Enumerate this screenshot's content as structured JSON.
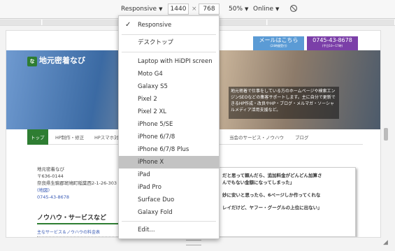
{
  "toolbar": {
    "device_label": "Responsive",
    "width": "1440",
    "times": "×",
    "height": "768",
    "zoom": "50%",
    "throttle": "Online"
  },
  "menu": {
    "items": [
      "Responsive",
      "デスクトップ",
      "Laptop with HiDPI screen",
      "Moto G4",
      "Galaxy S5",
      "Pixel 2",
      "Pixel 2 XL",
      "iPhone 5/SE",
      "iPhone 6/7/8",
      "iPhone 6/7/8 Plus",
      "iPhone X",
      "iPad",
      "iPad Pro",
      "Surface Duo",
      "Galaxy Fold",
      "Edit..."
    ],
    "checked": "Responsive",
    "highlighted": "iPhone X"
  },
  "page": {
    "cta_mail": "メールはこちら",
    "cta_mail_sub": "(24時間受付)",
    "cta_phone": "0745-43-8678",
    "cta_phone_sub": "(平日10～17時)",
    "logo_mark": "な",
    "logo_text": "地元密着なび",
    "hero_text": "地元密着で仕事をしている方のホームページや検索エンジンSEOなどの集客サポートします。主に自分で更新できるHP作成・改良やHP・ブログ・メルマガ・ソーシャルメディア活用支援など。",
    "nav": [
      "トップ",
      "HP制作・修正",
      "HPスマホ対",
      "当会のサービス・ノウハウ",
      "ブログ"
    ],
    "addr_name": "地元密着なび",
    "addr_zip": "〒636-0144",
    "addr_line": "奈良県生駒郡斑鳩町稲葉西2-1-26-303",
    "addr_map": "(地図)",
    "addr_phone": "0745-43-8678",
    "sidebar_heading": "ノウハウ・サービスなど",
    "sidebar_link": "主なサービス＆ノウハウの料金表",
    "content_1": "だと思って頼んだら、追加料金がどんどん加算さ",
    "content_2": "んでもない金額になってしまった」",
    "content_3": "妙に安いと思ったら、6ページしか作ってくれな",
    "content_4": "レイだけど、ヤフー・グーグルの上位に出ない」"
  },
  "colors": {
    "accent_green": "#2e7d32",
    "mail_blue": "#5b9bd5",
    "phone_purple": "#7b3fa8"
  }
}
